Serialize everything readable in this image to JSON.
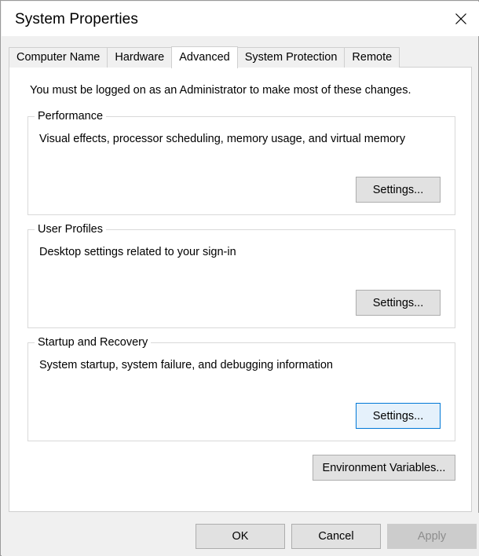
{
  "window": {
    "title": "System Properties",
    "close_icon": "close-icon"
  },
  "tabs": [
    {
      "label": "Computer Name",
      "selected": false
    },
    {
      "label": "Hardware",
      "selected": false
    },
    {
      "label": "Advanced",
      "selected": true
    },
    {
      "label": "System Protection",
      "selected": false
    },
    {
      "label": "Remote",
      "selected": false
    }
  ],
  "panel": {
    "admin_note": "You must be logged on as an Administrator to make most of these changes.",
    "groups": [
      {
        "legend": "Performance",
        "description": "Visual effects, processor scheduling, memory usage, and virtual memory",
        "button_label": "Settings...",
        "button_focused": false
      },
      {
        "legend": "User Profiles",
        "description": "Desktop settings related to your sign-in",
        "button_label": "Settings...",
        "button_focused": false
      },
      {
        "legend": "Startup and Recovery",
        "description": "System startup, system failure, and debugging information",
        "button_label": "Settings...",
        "button_focused": true
      }
    ],
    "environment_variables_label": "Environment Variables..."
  },
  "footer": {
    "ok_label": "OK",
    "cancel_label": "Cancel",
    "apply_label": "Apply",
    "apply_disabled": true
  },
  "colors": {
    "focus_border": "#0078d7",
    "focus_fill": "#e5f1fb",
    "button_face": "#e1e1e1",
    "disabled_face": "#cccccc",
    "disabled_text": "#8d8d8d",
    "dialog_bg": "#f0f0f0",
    "panel_bg": "#ffffff"
  }
}
